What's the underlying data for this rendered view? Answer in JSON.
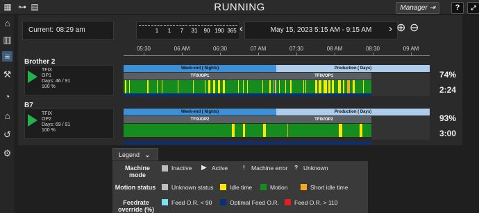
{
  "header": {
    "title": "RUNNING",
    "manager_label": "Manager",
    "help_label": "?"
  },
  "current": {
    "label": "Current:",
    "time": "08:29 am"
  },
  "periods": [
    "",
    "1",
    "1",
    "7",
    "31",
    "90",
    "190",
    "365"
  ],
  "date_range": "May 15, 2023 5:15 AM - 9:15 AM",
  "axis_ticks": [
    "05:30",
    "06 AM",
    "06:30",
    "07 AM",
    "07:30",
    "08 AM",
    "08:30",
    "09 AM"
  ],
  "machines": [
    {
      "name": "Brother 2",
      "line1": "TFIX",
      "line2": "OP1",
      "line3": "Days: 46 / 91",
      "line4": "100 %",
      "shift1": "Week-end ( Nights)",
      "shift2": "Production ( Days)",
      "job1": "TFIX/OP1",
      "job2": "TFIX/OP1",
      "utilization": "74%",
      "duration": "2:24"
    },
    {
      "name": "B7",
      "line1": "TFIX",
      "line2": "OP2",
      "line3": "Days: 69 / 91",
      "line4": "100 %",
      "shift1": "Week-end ( Nights)",
      "shift2": "Production ( Days)",
      "job1": "TFIX/OP2",
      "job2": "TFIX/OP2",
      "utilization": "93%",
      "duration": "3:00"
    }
  ],
  "legend": {
    "tab_label": "Legend",
    "machine_mode_label": "Machine mode",
    "motion_status_label": "Motion status",
    "feedrate_label": "Feedrate override (%)",
    "mode_items": [
      "Inactive",
      "Active",
      "Machine error",
      "Unknown"
    ],
    "motion_items": [
      "Unknown status",
      "Idle time",
      "Motion",
      "Short idle time"
    ],
    "feed_items": [
      "Feed O.R. < 90",
      "Optimal Feed O.R.",
      "Feed O.R. > 110"
    ]
  },
  "colors": {
    "motion": "#148c1e",
    "idle": "#ffe600",
    "short_idle": "#f5a623",
    "unknown": "#bdbdbd",
    "feed_low": "#7fe0f0",
    "feed_optimal": "#0a2f7a",
    "feed_high": "#e02020",
    "shift_weekend": "#3d8fd6",
    "shift_production": "#aecdec"
  },
  "icons": {
    "top": [
      "grid-icon",
      "tree-icon",
      "report-icon"
    ],
    "sidebar": [
      "home-icon",
      "machines-icon",
      "timeline-icon",
      "tools-icon",
      "gauge-icon",
      "factory-icon",
      "history-icon",
      "settings-icon"
    ]
  }
}
